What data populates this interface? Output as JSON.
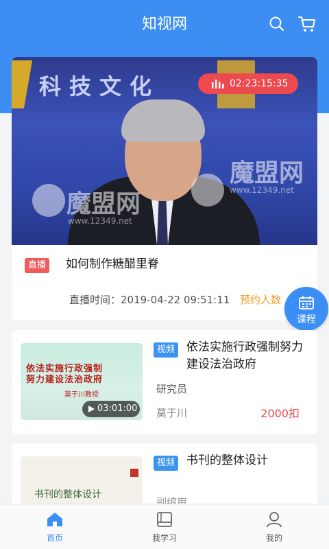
{
  "header": {
    "title": "知视网",
    "search_icon": "search-icon",
    "cart_icon": "cart-icon",
    "background": "#3d8ef3"
  },
  "live": {
    "timer": "02:23:15:35",
    "banner_text": "科技文化",
    "watermark": "魔盟网",
    "watermark_url": "www.12349.net",
    "badge": "直播",
    "title": "如何制作糖醋里脊",
    "time": "直播时间：2019-04-22 09:51:11",
    "reserve": "预约人数"
  },
  "float_button": {
    "label": "课程",
    "icon": "calendar-icon"
  },
  "courses": [
    {
      "badge": "视频",
      "title": "依法实施行政强制努力建设法治政府",
      "role": "研究员",
      "author": "莫于川",
      "price": "2000扣",
      "duration": "03:01:00",
      "thumb_line1": "依法实施行政强制",
      "thumb_line2": "努力建设法治政府",
      "thumb_caption": "莫于川教授"
    },
    {
      "badge": "视频",
      "title": "书刊的整体设计",
      "role": "副编审",
      "thumb_text": "书刊的整体设计"
    }
  ],
  "tabs": [
    {
      "label": "首页",
      "icon": "home-icon",
      "active": true
    },
    {
      "label": "我学习",
      "icon": "book-icon",
      "active": false
    },
    {
      "label": "我的",
      "icon": "user-icon",
      "active": false
    }
  ],
  "colors": {
    "accent": "#3b8ef3",
    "live_red": "#ef5b5b",
    "reserve_orange": "#f09b1d",
    "price_red": "#ef4545"
  }
}
